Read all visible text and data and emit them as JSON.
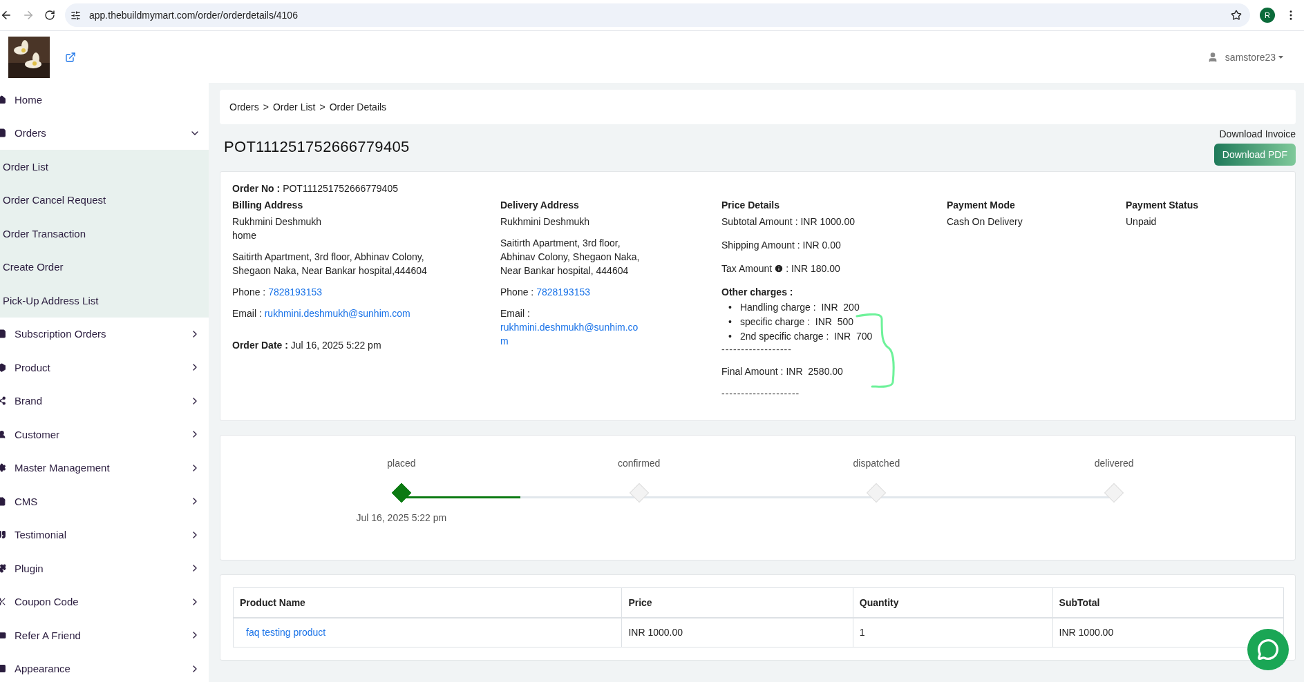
{
  "browser": {
    "url": "app.thebuildmymart.com/order/orderdetails/4106",
    "profile": "R"
  },
  "header": {
    "user": "samstore23"
  },
  "bullet": "•",
  "sidebar": {
    "items": [
      {
        "label": "Home",
        "kind": "link"
      },
      {
        "label": "Orders",
        "kind": "group",
        "expanded": true,
        "children": [
          {
            "label": "Order List"
          },
          {
            "label": "Order Cancel Request"
          },
          {
            "label": "Order Transaction"
          },
          {
            "label": "Create Order"
          },
          {
            "label": "Pick-Up Address List"
          }
        ]
      },
      {
        "label": "Subscription Orders",
        "kind": "group",
        "expanded": false
      },
      {
        "label": "Product",
        "kind": "group",
        "expanded": false
      },
      {
        "label": "Brand",
        "kind": "group",
        "expanded": false
      },
      {
        "label": "Customer",
        "kind": "group",
        "expanded": false
      },
      {
        "label": "Master Management",
        "kind": "group",
        "expanded": false
      },
      {
        "label": "CMS",
        "kind": "group",
        "expanded": false
      },
      {
        "label": "Testimonial",
        "kind": "group",
        "expanded": false
      },
      {
        "label": "Plugin",
        "kind": "group",
        "expanded": false
      },
      {
        "label": "Coupon Code",
        "kind": "group",
        "expanded": false
      },
      {
        "label": "Refer A Friend",
        "kind": "group",
        "expanded": false
      },
      {
        "label": "Appearance",
        "kind": "group",
        "expanded": false
      }
    ]
  },
  "breadcrumb": [
    "Orders",
    "Order List",
    "Order Details"
  ],
  "breadcrumb_separator": ">",
  "title": "POT111251752666779405",
  "invoice": {
    "label": "Download Invoice",
    "button": "Download PDF"
  },
  "order": {
    "order_no_label": "Order No :",
    "order_no": "POT111251752666779405",
    "billing": {
      "heading": "Billing Address",
      "name": "Rukhmini Deshmukh",
      "tag": "home",
      "address": "Saitirth Apartment, 3rd floor, Abhinav Colony, Shegaon Naka, Near Bankar hospital,444604",
      "phone_label": "Phone :",
      "phone": "7828193153",
      "email_label": "Email :",
      "email": "rukhmini.deshmukh@sunhim.com"
    },
    "order_date_label": "Order Date :",
    "order_date": "Jul 16, 2025 5:22 pm",
    "delivery": {
      "heading": "Delivery Address",
      "name": "Rukhmini Deshmukh",
      "address": "Saitirth Apartment, 3rd floor, Abhinav Colony, Shegaon Naka, Near Bankar hospital, 444604",
      "phone_label": "Phone :",
      "phone": "7828193153",
      "email_label": "Email :",
      "email_lines": [
        "rukhmini.deshmukh@sunhim.co",
        "m"
      ]
    },
    "price": {
      "heading": "Price Details",
      "lines": [
        {
          "kind": "plain",
          "label": "Subtotal Amount :",
          "value": "INR 1000.00"
        },
        {
          "kind": "plain",
          "label": "Shipping Amount :",
          "value": "INR 0.00"
        },
        {
          "kind": "info",
          "label": "Tax Amount",
          "value": ": INR  180.00"
        }
      ],
      "other_heading": "Other charges :",
      "charges": [
        "Handling charge :  INR  200",
        "specific charge :  INR  500",
        "2nd specific charge :  INR  700"
      ],
      "rule_1": "------------------",
      "final": "Final Amount : INR  2580.00",
      "rule_2": "--------------------"
    },
    "payment_mode": {
      "heading": "Payment Mode",
      "value": "Cash On Delivery"
    },
    "payment_status": {
      "heading": "Payment Status",
      "value": "Unpaid"
    }
  },
  "timeline": [
    {
      "label": "placed",
      "done": true,
      "date": "Jul 16, 2025 5:22 pm"
    },
    {
      "label": "confirmed",
      "done": false
    },
    {
      "label": "dispatched",
      "done": false
    },
    {
      "label": "delivered",
      "done": false
    }
  ],
  "table": {
    "columns": [
      "Product Name",
      "Price",
      "Quantity",
      "SubTotal"
    ],
    "rows": [
      [
        "faq testing product",
        "INR 1000.00",
        "1",
        "INR 1000.00"
      ]
    ]
  }
}
